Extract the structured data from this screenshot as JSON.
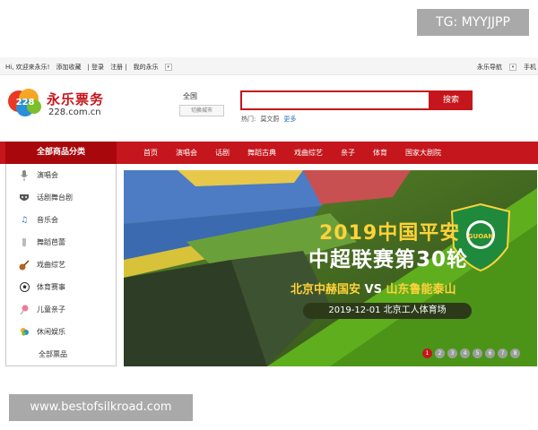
{
  "watermark_top": "TG: MYYJJPP",
  "watermark_bottom": "www.bestofsilkroad.com",
  "topbar": {
    "greeting": "Hi, 欢迎来永乐!",
    "favorite": "添加收藏",
    "login": "| 登录",
    "register": "注册 |",
    "my": "我的永乐",
    "nav_label": "永乐导航",
    "mobile": "手机"
  },
  "logo": {
    "name": "永乐票务",
    "domain": "228.com.cn"
  },
  "city": {
    "current": "全国",
    "switch_label": "切换城市"
  },
  "search": {
    "placeholder": "",
    "button": "搜索",
    "hot_label": "热门:",
    "hot_item": "莫文蔚",
    "more": "更多"
  },
  "nav": {
    "all_label": "全部商品分类",
    "items": [
      "首页",
      "演唱会",
      "话剧",
      "舞蹈古典",
      "戏曲综艺",
      "亲子",
      "体育",
      "国家大剧院"
    ]
  },
  "categories": [
    {
      "label": "演唱会",
      "icon": "microphone-icon"
    },
    {
      "label": "话剧舞台剧",
      "icon": "theater-mask-icon"
    },
    {
      "label": "音乐会",
      "icon": "music-note-icon"
    },
    {
      "label": "舞蹈芭蕾",
      "icon": "ballet-shoe-icon"
    },
    {
      "label": "戏曲综艺",
      "icon": "guitar-icon"
    },
    {
      "label": "体育赛事",
      "icon": "soccer-ball-icon"
    },
    {
      "label": "儿童亲子",
      "icon": "lollipop-icon"
    },
    {
      "label": "休闲娱乐",
      "icon": "leisure-icon"
    },
    {
      "label": "全部票品",
      "icon": ""
    }
  ],
  "banner": {
    "title1": "2019中国平安",
    "title2": "中超联赛第30轮",
    "team_home": "北京中赫国安",
    "vs": "VS",
    "team_away": "山东鲁能泰山",
    "date_venue": "2019-12-01 北京工人体育场",
    "badge_text": "GUOAN"
  },
  "pager": {
    "pages": [
      "1",
      "2",
      "3",
      "4",
      "5",
      "6",
      "7",
      "8"
    ],
    "active": 1
  },
  "colors": {
    "brand_red": "#c4161c",
    "nav_dark": "#a8070c",
    "banner_green": "#3a5a1e",
    "accent_yellow": "#ffd23a"
  }
}
